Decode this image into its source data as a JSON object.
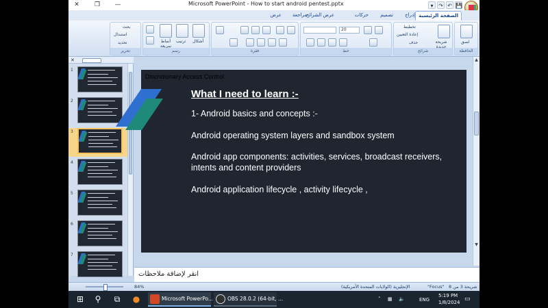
{
  "window": {
    "title": "Microsoft PowerPoint - How to start android pentest.pptx",
    "controls": {
      "close": "✕",
      "restore": "❐",
      "minimize": "—"
    }
  },
  "quick_access": [
    "▾",
    "↷",
    "↶",
    "💾"
  ],
  "tabs": [
    {
      "label": "الصفحة الرئيسية",
      "active": true
    },
    {
      "label": "إدراج",
      "active": false
    },
    {
      "label": "تصميم",
      "active": false
    },
    {
      "label": "حركات",
      "active": false
    },
    {
      "label": "عرض الشرائح",
      "active": false
    },
    {
      "label": "مراجعة",
      "active": false
    },
    {
      "label": "عرض",
      "active": false
    }
  ],
  "ribbon": {
    "groups": {
      "clipboard": "الحافظة",
      "slides": "شرائح",
      "font": "خط",
      "paragraph": "فقرة",
      "drawing": "رسم",
      "editing": "تحرير"
    },
    "items": {
      "paste": "لصق",
      "new_slide": "شريحة جديدة",
      "layout": "تخطيط",
      "reset": "إعادة التعيين",
      "delete": "حذف",
      "font_size": "20",
      "shapes": "أشكال",
      "arrange": "ترتيب",
      "quick_styles": "أنماط سريعة",
      "find": "بحث",
      "replace": "استبدال",
      "select": "تحديد"
    }
  },
  "slide_thumbnails": [
    {
      "number": "1",
      "selected": false
    },
    {
      "number": "2",
      "selected": false
    },
    {
      "number": "3",
      "selected": true
    },
    {
      "number": "4",
      "selected": false
    },
    {
      "number": "5",
      "selected": false
    },
    {
      "number": "6",
      "selected": false
    },
    {
      "number": "7",
      "selected": false
    }
  ],
  "slide": {
    "label": "Discretionary Access Control",
    "title": "What I need to learn :-",
    "paragraphs": [
      "1- Android basics and concepts :-",
      "Android operating system layers and sandbox system",
      "Android app components: activities, services, broadcast receivers, intents and content providers",
      "Android application lifecycle , activity lifecycle ,"
    ]
  },
  "notes_placeholder": "انقر لإضافة ملاحظات",
  "status": {
    "slide_counter": "شريحة 3 من 8",
    "theme": "\"Focus\"",
    "language": "الإنجليزية (الولايات المتحدة الأمريكية)",
    "zoom": "84%"
  },
  "taskbar": {
    "powerpoint_label": "Microsoft PowerPo...",
    "obs_label": "OBS 28.0.2 (64-bit, ...",
    "language": "ENG",
    "time": "5:19 PM",
    "date": "1/8/2024"
  }
}
